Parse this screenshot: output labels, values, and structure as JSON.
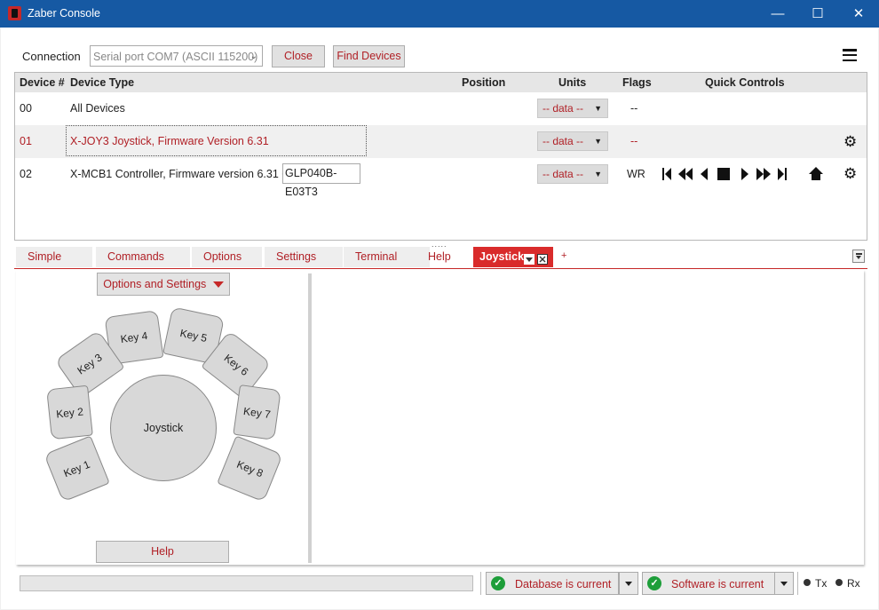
{
  "window": {
    "title": "Zaber Console",
    "minimize": "—",
    "maximize": "☐",
    "close": "✕"
  },
  "connection": {
    "label": "Connection",
    "port": "Serial port COM7 (ASCII 115200)",
    "close_label": "Close",
    "find_label": "Find Devices"
  },
  "grid": {
    "headers": {
      "device_num": "Device #",
      "device_type": "Device Type",
      "position": "Position",
      "units": "Units",
      "flags": "Flags",
      "quick_controls": "Quick Controls"
    },
    "rows": [
      {
        "num": "00",
        "type": "All Devices",
        "units": "-- data --",
        "flags": "--"
      },
      {
        "num": "01",
        "type": "X-JOY3 Joystick, Firmware Version 6.31",
        "units": "-- data --",
        "flags": "--"
      },
      {
        "num": "02",
        "type": "X-MCB1 Controller, Firmware version 6.31 +",
        "peripheral": "GLP040B-E03T3",
        "units": "-- data --",
        "flags": "WR"
      }
    ]
  },
  "splitter": ".....",
  "tabs": [
    {
      "label": "Simple"
    },
    {
      "label": "Commands"
    },
    {
      "label": "Options"
    },
    {
      "label": "Settings"
    },
    {
      "label": "Terminal"
    },
    {
      "label": "Help"
    },
    {
      "label": "Joystick"
    }
  ],
  "tab_add": "+",
  "joystick_panel": {
    "options_label": "Options and Settings",
    "joystick_label": "Joystick",
    "help_label": "Help",
    "keys": {
      "k1": "Key 1",
      "k2": "Key 2",
      "k3": "Key 3",
      "k4": "Key 4",
      "k5": "Key 5",
      "k6": "Key 6",
      "k7": "Key 7",
      "k8": "Key 8"
    }
  },
  "status": {
    "database": "Database is current",
    "software": "Software is current",
    "tx": "Tx",
    "rx": "Rx"
  },
  "colors": {
    "titlebar": "#1659a3",
    "accent": "#b01f25",
    "active_tab": "#d92b2b",
    "ok_green": "#1e9e3a"
  }
}
